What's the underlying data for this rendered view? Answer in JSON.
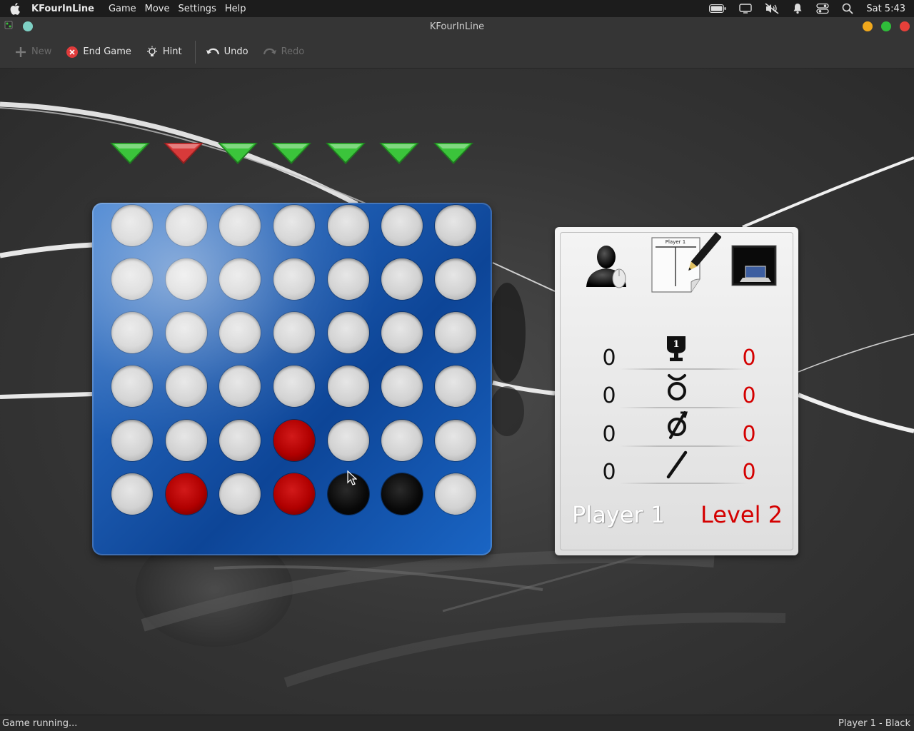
{
  "menubar": {
    "app_name": "KFourInLine",
    "menus": [
      "Game",
      "Move",
      "Settings",
      "Help"
    ],
    "clock": "Sat 5:43"
  },
  "window": {
    "title": "KFourInLine",
    "buttons": {
      "minimize_color": "#f0a81c",
      "maximize_color": "#2fbd3a",
      "close_color": "#e6403a"
    }
  },
  "toolbar": {
    "new_label": "New",
    "end_game_label": "End Game",
    "hint_label": "Hint",
    "undo_label": "Undo",
    "redo_label": "Redo"
  },
  "board": {
    "columns": 7,
    "rows": 6,
    "column_arrows": [
      "green",
      "red",
      "green",
      "green",
      "green",
      "green",
      "green"
    ],
    "grid": [
      [
        "empty",
        "empty",
        "empty",
        "empty",
        "empty",
        "empty",
        "empty"
      ],
      [
        "empty",
        "empty",
        "empty",
        "empty",
        "empty",
        "empty",
        "empty"
      ],
      [
        "empty",
        "empty",
        "empty",
        "empty",
        "empty",
        "empty",
        "empty"
      ],
      [
        "empty",
        "empty",
        "empty",
        "empty",
        "empty",
        "empty",
        "empty"
      ],
      [
        "empty",
        "empty",
        "empty",
        "red",
        "empty",
        "empty",
        "empty"
      ],
      [
        "empty",
        "red",
        "empty",
        "red",
        "black",
        "black",
        "empty"
      ]
    ],
    "colors": {
      "board": "#1d5bb0",
      "red_piece": "#b00000",
      "black_piece": "#080808",
      "arrow_green": "#3bc43b",
      "arrow_red": "#d83a3a"
    }
  },
  "scores": {
    "player_icon": "user-with-mouse-icon",
    "turn_icon": "note-pencil-icon",
    "turn_note_label": "Player 1",
    "computer_icon": "laptop-icon",
    "rows": [
      {
        "icon": "trophy-icon",
        "left": "0",
        "right": "0"
      },
      {
        "icon": "loss-icon",
        "left": "0",
        "right": "0"
      },
      {
        "icon": "draw-icon",
        "left": "0",
        "right": "0"
      },
      {
        "icon": "broken-icon",
        "left": "0",
        "right": "0"
      }
    ],
    "player_name": "Player 1",
    "level_name": "Level 2"
  },
  "status": {
    "left": "Game running...",
    "right": "Player 1 - Black"
  }
}
